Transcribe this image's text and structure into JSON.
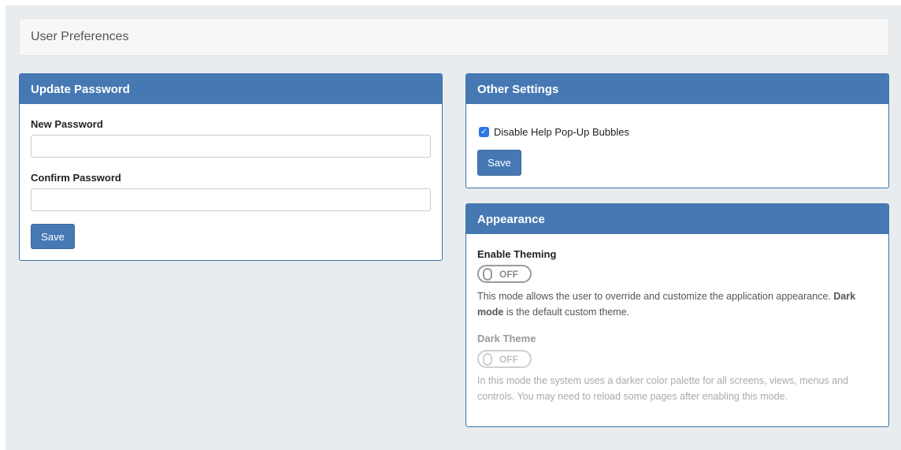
{
  "page": {
    "title": "User Preferences"
  },
  "update_password": {
    "header": "Update Password",
    "new_password_label": "New Password",
    "new_password_value": "",
    "confirm_password_label": "Confirm Password",
    "confirm_password_value": "",
    "save_label": "Save"
  },
  "other_settings": {
    "header": "Other Settings",
    "disable_help_label": "Disable Help Pop-Up Bubbles",
    "disable_help_checked": true,
    "save_label": "Save"
  },
  "appearance": {
    "header": "Appearance",
    "enable_theming_label": "Enable Theming",
    "enable_theming_state": "OFF",
    "theming_desc_1": "This mode allows the user to override and customize the application appearance.",
    "theming_desc_bold": "Dark mode",
    "theming_desc_2": " is the default custom theme.",
    "dark_theme_label": "Dark Theme",
    "dark_theme_state": "OFF",
    "dark_theme_desc": "In this mode the system uses a darker color palette for all screens, views, menus and controls. You may need to reload some pages after enabling this mode."
  },
  "colors": {
    "panel_header": "#4679b4",
    "page_background": "#e9ecef",
    "checkbox": "#2b78e4"
  }
}
